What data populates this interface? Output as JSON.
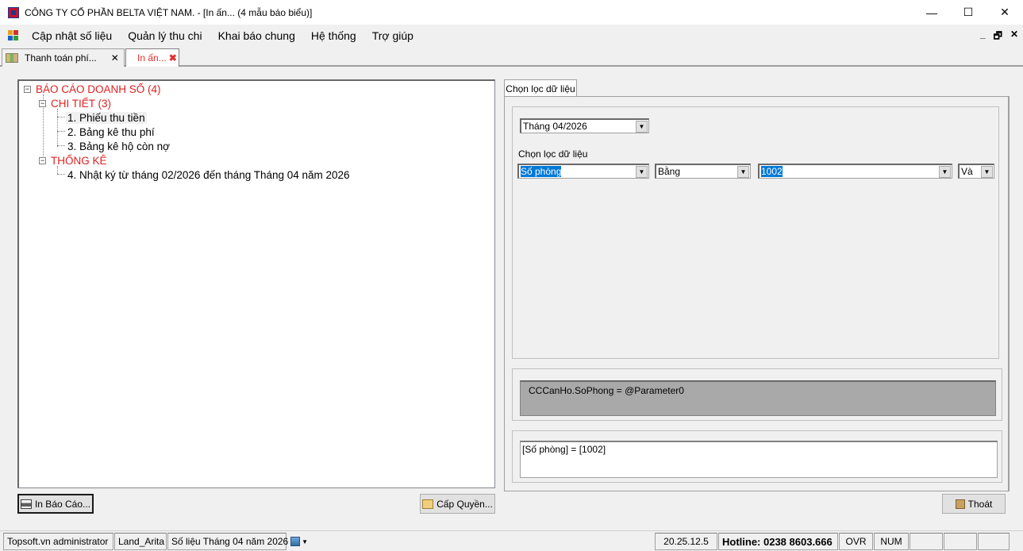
{
  "window": {
    "title": "CÔNG TY CỔ PHẦN BELTA VIỆT NAM.  - [In ấn... (4 mẫu báo biểu)]",
    "minimize": "—",
    "maximize": "☐",
    "close": "✕"
  },
  "menu": {
    "items": [
      "Cập nhật số liệu",
      "Quản lý thu chi",
      "Khai báo chung",
      "Hệ thống",
      "Trợ giúp"
    ],
    "mdi_min": "_",
    "mdi_restore": "🗗",
    "mdi_close": "✕"
  },
  "tabs": [
    {
      "label": "Thanh toán phí...",
      "close": "✕"
    },
    {
      "label": "In ấn...",
      "close": "✖"
    }
  ],
  "tree": {
    "root": "BÁO CÁO DOANH SỐ (4)",
    "group1": "CHI TIẾT (3)",
    "item1": "1. Phiếu thu tiền",
    "item2": "2. Bảng kê thu phí",
    "item3": "3. Bảng kê hộ còn nợ",
    "group2": "THỐNG KÊ",
    "item4": "4. Nhật ký từ tháng 02/2026 đến tháng Tháng 04 năm 2026"
  },
  "buttons": {
    "print": "In Báo Cáo...",
    "permission": "Cấp Quyền...",
    "exit": "Thoát"
  },
  "filter": {
    "tab_label": "Chọn lọc dữ liệu",
    "month_value": "Tháng 04/2026",
    "section_label": "Chọn lọc dữ liệu",
    "field_value": "Số phòng",
    "operator_value": "Bằng",
    "value_value": "1002",
    "logic_value": "Và",
    "expression": "CCCanHo.SoPhong = @Parameter0",
    "readable": "[Số phòng] = [1002]"
  },
  "status": {
    "user": "Topsoft.vn administrator",
    "project": "Land_Arita",
    "period": "Số liệu Tháng 04 năm 2026",
    "version": "20.25.12.5",
    "hotline": "Hotline: 0238 8603.666",
    "ovr": "OVR",
    "num": "NUM"
  },
  "colors": {
    "accent_red": "#e02020",
    "selection_blue": "#0078d7",
    "expr_bg": "#a9a9a9"
  }
}
